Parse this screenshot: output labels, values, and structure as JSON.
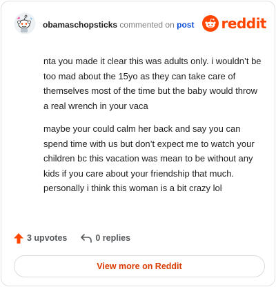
{
  "comment": {
    "username": "obamaschopsticks",
    "action": "commented on",
    "post_link": "post",
    "paragraphs": [
      "nta you made it clear this was adults only. i wouldn’t be too mad about the 15yo as they can take care of themselves most of the time but the baby would throw a real wrench in your vaca",
      "maybe your could calm her back and say you can spend time with us but don’t expect me to watch your children bc this vacation was mean to be without any kids if you care about your friendship that much. personally i think this woman is a bit crazy lol"
    ],
    "upvotes": "3 upvotes",
    "replies": "0 replies"
  },
  "brand": {
    "logo_text": "reddit",
    "color": "#ff4500"
  },
  "view_more_label": "View more on Reddit",
  "icons": [
    "avatar-icon",
    "reddit-logo-icon",
    "upvote-arrow-icon",
    "reply-arrow-icon"
  ]
}
